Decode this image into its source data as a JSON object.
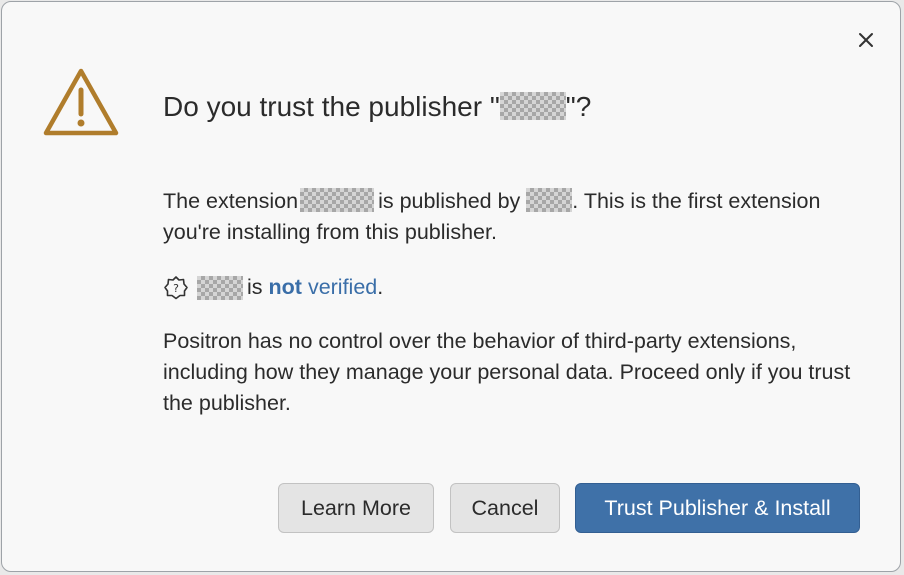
{
  "dialog": {
    "title_prefix": "Do you trust the publisher \"",
    "title_suffix": "\"?",
    "extension_text_1": "The extension",
    "extension_text_2": "is published by",
    "extension_text_3": ". This is the first extension you're installing from this publisher.",
    "verify_is": "is",
    "verify_not": "not",
    "verify_verified": "verified",
    "verify_period": ".",
    "body_text": "Positron has no control over the behavior of third-party extensions, including how they manage your personal data. Proceed only if you trust the publisher."
  },
  "buttons": {
    "learn_more": "Learn More",
    "cancel": "Cancel",
    "trust": "Trust Publisher & Install"
  },
  "icons": {
    "warning": "warning-triangle-icon",
    "close": "close-icon",
    "unverified": "unverified-badge-icon"
  },
  "colors": {
    "warning": "#b07d2c",
    "link": "#3a6ea8",
    "primary_button": "#3f71a8"
  }
}
